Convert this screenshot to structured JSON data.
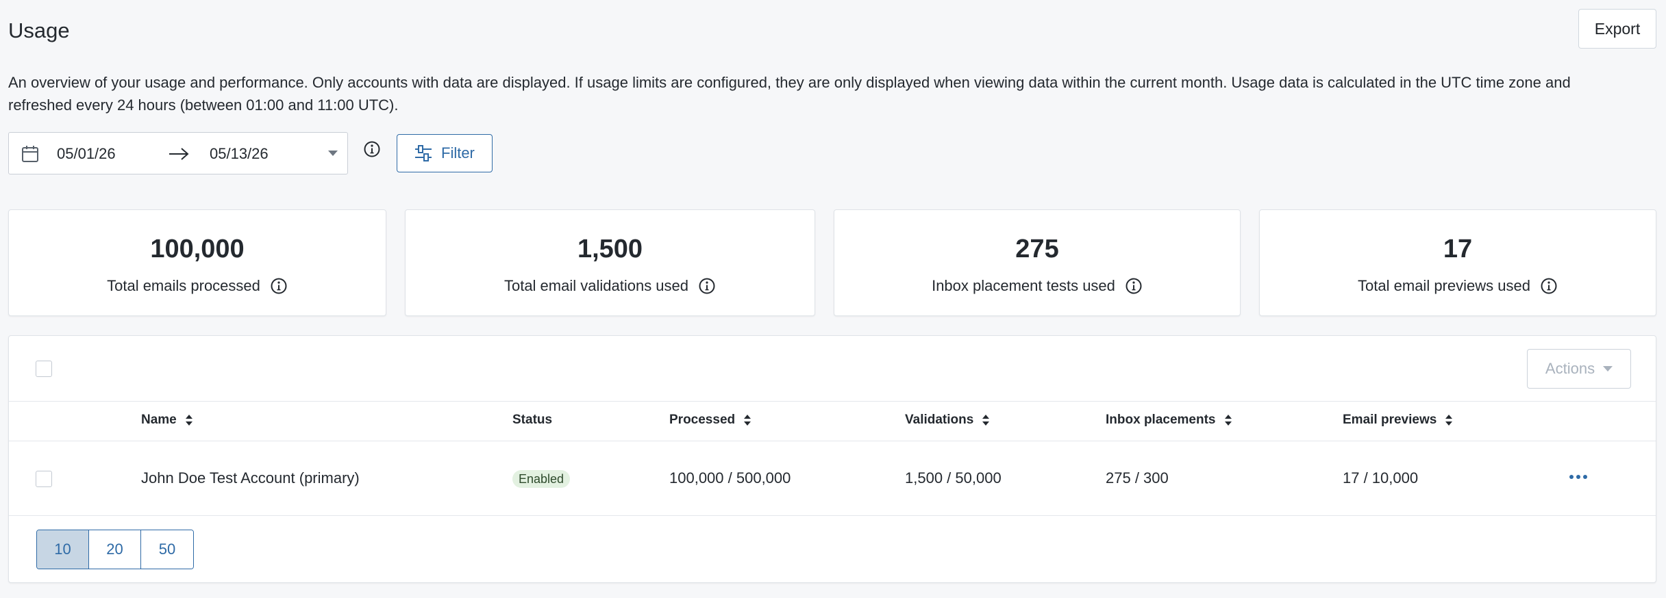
{
  "header": {
    "title": "Usage",
    "export_label": "Export"
  },
  "description": "An overview of your usage and performance. Only accounts with data are displayed. If usage limits are configured, they are only displayed when viewing data within the current month. Usage data is calculated in the UTC time zone and refreshed every 24 hours (between 01:00 and 11:00 UTC).",
  "date_range": {
    "start": "05/01/26",
    "end": "05/13/26"
  },
  "filter": {
    "label": "Filter"
  },
  "stats": [
    {
      "value": "100,000",
      "label": "Total emails processed"
    },
    {
      "value": "1,500",
      "label": "Total email validations used"
    },
    {
      "value": "275",
      "label": "Inbox placement tests used"
    },
    {
      "value": "17",
      "label": "Total email previews used"
    }
  ],
  "table": {
    "actions_label": "Actions",
    "columns": {
      "name": "Name",
      "status": "Status",
      "processed": "Processed",
      "validations": "Validations",
      "inbox_placements": "Inbox placements",
      "email_previews": "Email previews"
    },
    "rows": [
      {
        "name": "John Doe Test Account (primary)",
        "status": "Enabled",
        "processed": "100,000 / 500,000",
        "validations": "1,500 / 50,000",
        "inbox_placements": "275 / 300",
        "email_previews": "17 / 10,000"
      }
    ]
  },
  "pagination": {
    "page_sizes": [
      "10",
      "20",
      "50"
    ],
    "selected": "10"
  },
  "colors": {
    "accent": "#2e6aa6",
    "background": "#f6f7f9",
    "badge_bg": "#e3f1e1",
    "selected_page_bg": "#c7d6e4"
  }
}
